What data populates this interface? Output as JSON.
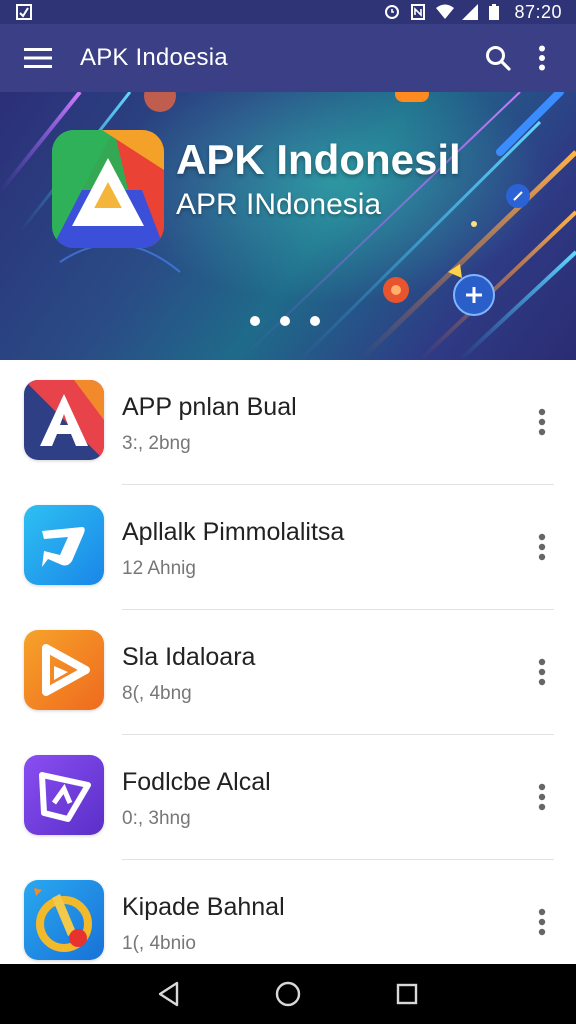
{
  "status_bar": {
    "time": "87:20",
    "icons": [
      "notification-icon",
      "alarm-icon",
      "nfc-icon",
      "wifi-icon",
      "signal-icon",
      "battery-icon"
    ]
  },
  "app_bar": {
    "title": "APK Indoesia",
    "icons": [
      "menu-icon",
      "search-icon",
      "more-vert-icon"
    ]
  },
  "banner": {
    "title": "APK Indonesil",
    "subtitle": "APR INdonesia",
    "dots_count": 3
  },
  "apps": [
    {
      "title": "APP pnlan Bual",
      "subtitle": "3:, 2bng",
      "icon": "letter-a-app-icon"
    },
    {
      "title": "Apllalk Pimmolalitsa",
      "subtitle": "12 Ahnig",
      "icon": "chat-bubble-app-icon"
    },
    {
      "title": "Sla Idaloara",
      "subtitle": "8(, 4bng",
      "icon": "play-app-icon"
    },
    {
      "title": "Fodlcbe Alcal",
      "subtitle": "0:, 3hng",
      "icon": "video-editor-app-icon"
    },
    {
      "title": "Kipade Bahnal",
      "subtitle": "1(, 4bnio",
      "icon": "pencil-app-icon"
    }
  ],
  "nav_bar": {
    "icons": [
      "back-icon",
      "home-icon",
      "recents-icon"
    ]
  },
  "colors": {
    "status_bar": "#2f3476",
    "app_bar": "#3a3f86",
    "banner_start": "#2b2f78",
    "banner_mid": "#1f6b8a",
    "nav_bar": "#000000"
  }
}
